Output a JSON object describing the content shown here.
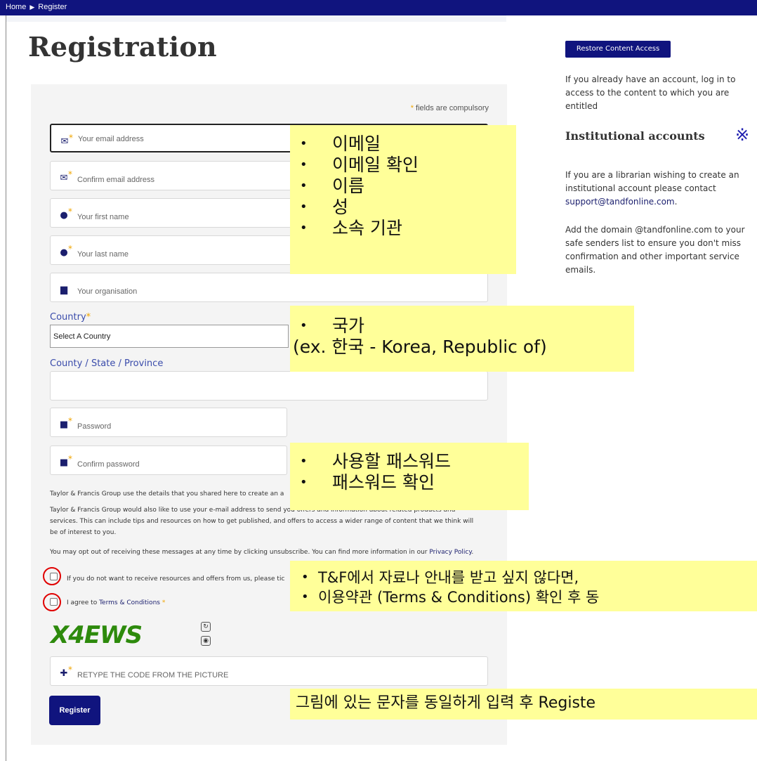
{
  "breadcrumb": {
    "home": "Home",
    "current": "Register"
  },
  "page_title": "Registration",
  "form": {
    "compulsory_star": "*",
    "compulsory_text": " fields are compulsory",
    "email_placeholder": "Your email address",
    "confirm_email_placeholder": "Confirm email address",
    "first_name_placeholder": "Your first name",
    "last_name_placeholder": "Your last name",
    "organisation_placeholder": "Your organisation",
    "country_label": "Country",
    "country_selected": "Select A Country",
    "county_label": "County / State / Province",
    "password_placeholder": "Password",
    "confirm_password_placeholder": "Confirm password",
    "para1": "Taylor & Francis Group use the details that you shared here to create an a",
    "para2_line1": "Taylor & Francis Group would also like to use your e-mail address to send you offers and information about related products and",
    "para2_line2": "services. This can include tips and resources on how to get published, and offers to access a wider range of content that we think will",
    "para2_line3": "be of interest to you.",
    "para3": "You may opt out of receiving these messages at any time by clicking unsubscribe. You can find more information in our ",
    "privacy_link": "Privacy Policy",
    "para3_end": ".",
    "optout_label": "If you do not want to receive resources and offers from us, please tic",
    "agree_prefix": "I agree to ",
    "terms_link": "Terms & Conditions",
    "captcha_text": "X4EWS",
    "captcha_placeholder": "RETYPE THE CODE FROM THE PICTURE",
    "register_label": "Register"
  },
  "sidebar": {
    "restore_label": "Restore Content Access",
    "login_text": "If you already have an account, log in to access to the content to which you are entitled",
    "institutional_heading": "Institutional accounts",
    "ref_mark": "※",
    "librarian_text": "If you are a librarian wishing to create an institutional account please contact ",
    "support_email": "support@tandfonline.com",
    "support_end": ".",
    "domain_text": "Add the domain @tandfonline.com to your safe senders list to ensure you don't miss confirmation and other important service emails."
  },
  "annotations": {
    "personal_items": [
      "이메일",
      "이메일 확인",
      "이름",
      "성",
      "소속 기관"
    ],
    "country_item": "국가",
    "country_example": "(ex. 한국 - Korea, Republic of)",
    "password_items": [
      "사용할 패스워드",
      "패스워드 확인"
    ],
    "consent_items": [
      "T&F에서 자료나 안내를 받고 싶지 않다면,",
      "이용약관 (Terms & Conditions) 확인 후 동"
    ],
    "captcha_note": "그림에 있는 문자를 동일하게 입력 후 Registe"
  },
  "colors": {
    "brand_navy": "#10147e",
    "required_star": "#f0a500",
    "note_yellow": "#ffff99",
    "circle_red": "#e00000",
    "captcha_green": "#2d8a0c"
  }
}
